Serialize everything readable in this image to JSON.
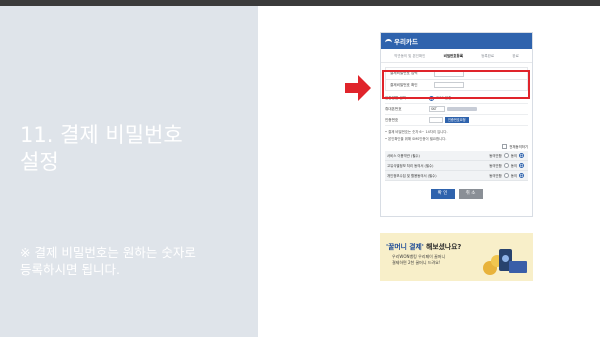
{
  "slide": {
    "title_line1": "11. 결제 비밀번호",
    "title_line2": "설정",
    "body_line1": "※ 결제 비밀번호는 원하는 숫자로",
    "body_line2": "등록하시면 됩니다."
  },
  "card": {
    "logo": "우리카드",
    "steps": [
      "약관동의 및 본인확인",
      "비밀번호등록",
      "등록완료",
      "완료"
    ],
    "pw_label": "결제비밀번호 입력",
    "pw_confirm_label": "결제비밀번호 확인",
    "auth_label": "인증방법 선택",
    "auth_option": "SMS 인증",
    "phone_label": "휴대폰번호",
    "carrier": "SKT",
    "code_label": "인증번호",
    "code_button": "인증번호요청",
    "note1": "• 결제 비밀번호는 숫자 6~ 14자리 입니다.",
    "note2": "• 본인확인을 위해 SMS인증이 필요합니다.",
    "agree_all": "전체동의하기",
    "agreements": [
      "서비스 이용약관 (필수)",
      "고유식별정보 처리 동의서 (필수)",
      "개인정보수집 및 활용동의서 (필수)"
    ],
    "disagree": "동의안함",
    "agree": "동의",
    "confirm": "확 인",
    "cancel": "취 소"
  },
  "banner": {
    "title_quote": "'꿀머니 결제'",
    "title_rest": " 해보셨나요?",
    "line1": "우리WON뱅킹 우리페이 꿀머니",
    "line2": "결제하면 2천 꿀머니 드려요!"
  },
  "colors": {
    "left_panel": "#dfe4ea",
    "brand_blue": "#2f63ad",
    "highlight_red": "#e0242b",
    "banner_bg": "#f8efc9"
  }
}
